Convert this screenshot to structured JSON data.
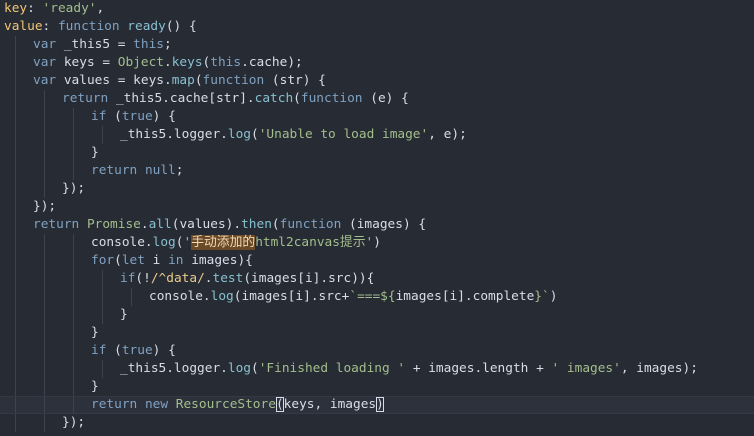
{
  "editor": {
    "lines": [
      {
        "indent": 0,
        "active": false,
        "tokens": [
          [
            "prop",
            "key"
          ],
          [
            "punct",
            ": "
          ],
          [
            "str",
            "'ready'"
          ],
          [
            "punct",
            ","
          ]
        ]
      },
      {
        "indent": 0,
        "active": false,
        "tokens": [
          [
            "prop",
            "value"
          ],
          [
            "punct",
            ": "
          ],
          [
            "kw",
            "function "
          ],
          [
            "fn",
            "ready"
          ],
          [
            "punct",
            "() {"
          ]
        ]
      },
      {
        "indent": 1,
        "active": false,
        "tokens": [
          [
            "kw",
            "var "
          ],
          [
            "text",
            "_this5 = "
          ],
          [
            "kw",
            "this"
          ],
          [
            "punct",
            ";"
          ]
        ]
      },
      {
        "indent": 1,
        "active": false,
        "tokens": [
          [
            "kw",
            "var "
          ],
          [
            "text",
            "keys = "
          ],
          [
            "type",
            "Object"
          ],
          [
            "punct",
            "."
          ],
          [
            "fn",
            "keys"
          ],
          [
            "punct",
            "("
          ],
          [
            "kw",
            "this"
          ],
          [
            "punct",
            "."
          ],
          [
            "text",
            "cache"
          ],
          [
            "punct",
            ");"
          ]
        ]
      },
      {
        "indent": 1,
        "active": false,
        "tokens": [
          [
            "kw",
            "var "
          ],
          [
            "text",
            "values = keys."
          ],
          [
            "fn",
            "map"
          ],
          [
            "punct",
            "("
          ],
          [
            "kw",
            "function "
          ],
          [
            "punct",
            "("
          ],
          [
            "text",
            "str"
          ],
          [
            "punct",
            ") {"
          ]
        ]
      },
      {
        "indent": 2,
        "active": false,
        "tokens": [
          [
            "kw",
            "return "
          ],
          [
            "text",
            "_this5.cache[str]."
          ],
          [
            "fn",
            "catch"
          ],
          [
            "punct",
            "("
          ],
          [
            "kw",
            "function "
          ],
          [
            "punct",
            "("
          ],
          [
            "text",
            "e"
          ],
          [
            "punct",
            ") {"
          ]
        ]
      },
      {
        "indent": 3,
        "active": false,
        "tokens": [
          [
            "kw",
            "if "
          ],
          [
            "punct",
            "("
          ],
          [
            "kw",
            "true"
          ],
          [
            "punct",
            ") {"
          ]
        ]
      },
      {
        "indent": 4,
        "active": false,
        "tokens": [
          [
            "text",
            "_this5.logger."
          ],
          [
            "fn",
            "log"
          ],
          [
            "punct",
            "("
          ],
          [
            "str",
            "'Unable to load image'"
          ],
          [
            "punct",
            ", "
          ],
          [
            "text",
            "e"
          ],
          [
            "punct",
            ");"
          ]
        ]
      },
      {
        "indent": 3,
        "active": false,
        "tokens": [
          [
            "punct",
            "}"
          ]
        ]
      },
      {
        "indent": 3,
        "active": false,
        "tokens": [
          [
            "kw",
            "return "
          ],
          [
            "kw",
            "null"
          ],
          [
            "punct",
            ";"
          ]
        ]
      },
      {
        "indent": 2,
        "active": false,
        "tokens": [
          [
            "punct",
            "});"
          ]
        ]
      },
      {
        "indent": 1,
        "active": false,
        "tokens": [
          [
            "punct",
            "});"
          ]
        ]
      },
      {
        "indent": 1,
        "active": false,
        "tokens": [
          [
            "kw",
            "return "
          ],
          [
            "type",
            "Promise"
          ],
          [
            "punct",
            "."
          ],
          [
            "fn",
            "all"
          ],
          [
            "punct",
            "("
          ],
          [
            "text",
            "values"
          ],
          [
            "punct",
            ")."
          ],
          [
            "fn",
            "then"
          ],
          [
            "punct",
            "("
          ],
          [
            "kw",
            "function "
          ],
          [
            "punct",
            "("
          ],
          [
            "text",
            "images"
          ],
          [
            "punct",
            ") {"
          ]
        ]
      },
      {
        "indent": 3,
        "active": false,
        "tokens": [
          [
            "text",
            "console."
          ],
          [
            "fn",
            "log"
          ],
          [
            "punct",
            "("
          ],
          [
            "str",
            "'"
          ],
          [
            "hl",
            "手动添加的"
          ],
          [
            "str",
            "html2canvas提示'"
          ],
          [
            "punct",
            ")"
          ]
        ]
      },
      {
        "indent": 3,
        "active": false,
        "tokens": [
          [
            "kw",
            "for"
          ],
          [
            "punct",
            "("
          ],
          [
            "kw",
            "let "
          ],
          [
            "text",
            "i "
          ],
          [
            "kw",
            "in "
          ],
          [
            "text",
            "images"
          ],
          [
            "punct",
            "){"
          ]
        ]
      },
      {
        "indent": 4,
        "active": false,
        "tokens": [
          [
            "kw",
            "if"
          ],
          [
            "punct",
            "(!"
          ],
          [
            "regex",
            "/^data/"
          ],
          [
            "punct",
            "."
          ],
          [
            "fn",
            "test"
          ],
          [
            "punct",
            "("
          ],
          [
            "text",
            "images[i].src"
          ],
          [
            "punct",
            "))"
          ],
          [
            "punct",
            "{"
          ]
        ]
      },
      {
        "indent": 5,
        "active": false,
        "tokens": [
          [
            "text",
            "console."
          ],
          [
            "fn",
            "log"
          ],
          [
            "punct",
            "("
          ],
          [
            "text",
            "images[i].src+"
          ],
          [
            "str",
            "`===${"
          ],
          [
            "text",
            "images[i].complete"
          ],
          [
            "str",
            "}`"
          ],
          [
            "punct",
            ")"
          ]
        ]
      },
      {
        "indent": 4,
        "active": false,
        "tokens": [
          [
            "punct",
            "}"
          ]
        ]
      },
      {
        "indent": 3,
        "active": false,
        "tokens": [
          [
            "punct",
            "}"
          ]
        ]
      },
      {
        "indent": 3,
        "active": false,
        "tokens": [
          [
            "kw",
            "if "
          ],
          [
            "punct",
            "("
          ],
          [
            "kw",
            "true"
          ],
          [
            "punct",
            ") {"
          ]
        ]
      },
      {
        "indent": 4,
        "active": false,
        "tokens": [
          [
            "text",
            "_this5.logger."
          ],
          [
            "fn",
            "log"
          ],
          [
            "punct",
            "("
          ],
          [
            "str",
            "'Finished loading '"
          ],
          [
            "text",
            " + images.length + "
          ],
          [
            "str",
            "' images'"
          ],
          [
            "punct",
            ", "
          ],
          [
            "text",
            "images"
          ],
          [
            "punct",
            ");"
          ]
        ]
      },
      {
        "indent": 3,
        "active": false,
        "tokens": [
          [
            "punct",
            "}"
          ]
        ]
      },
      {
        "indent": 3,
        "active": true,
        "tokens": [
          [
            "kw",
            "return "
          ],
          [
            "kw",
            "new "
          ],
          [
            "type",
            "ResourceStore"
          ],
          [
            "match",
            "("
          ],
          [
            "text",
            "keys, images"
          ],
          [
            "match",
            ")"
          ]
        ]
      },
      {
        "indent": 2,
        "active": false,
        "tokens": [
          [
            "punct",
            "});"
          ]
        ]
      }
    ]
  },
  "colors": {
    "background": "#262b34",
    "keyword": "#81a1c1",
    "string": "#a3be8c",
    "function": "#88c0d0",
    "property": "#f0c674"
  }
}
